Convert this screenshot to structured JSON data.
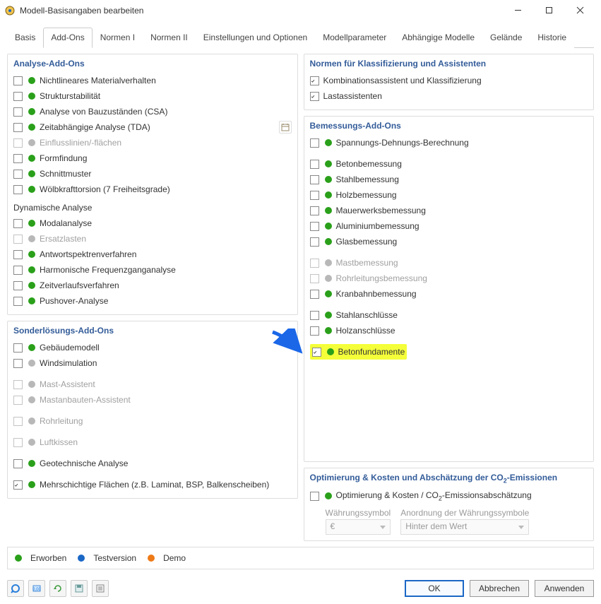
{
  "window": {
    "title": "Modell-Basisangaben bearbeiten"
  },
  "tabs": [
    "Basis",
    "Add-Ons",
    "Normen I",
    "Normen II",
    "Einstellungen und Optionen",
    "Modellparameter",
    "Abhängige Modelle",
    "Gelände",
    "Historie"
  ],
  "active_tab": 1,
  "panels": {
    "analysis": {
      "title": "Analyse-Add-Ons",
      "items": [
        {
          "label": "Nichtlineares Materialverhalten",
          "dot": "green",
          "checked": false,
          "disabled": false
        },
        {
          "label": "Strukturstabilität",
          "dot": "green",
          "checked": false,
          "disabled": false
        },
        {
          "label": "Analyse von Bauzuständen (CSA)",
          "dot": "green",
          "checked": false,
          "disabled": false
        },
        {
          "label": "Zeitabhängige Analyse (TDA)",
          "dot": "green",
          "checked": false,
          "disabled": false,
          "has_icon": true
        },
        {
          "label": "Einflusslinien/-flächen",
          "dot": "gray",
          "checked": false,
          "disabled": true
        },
        {
          "label": "Formfindung",
          "dot": "green",
          "checked": false,
          "disabled": false
        },
        {
          "label": "Schnittmuster",
          "dot": "green",
          "checked": false,
          "disabled": false
        },
        {
          "label": "Wölbkrafttorsion (7 Freiheitsgrade)",
          "dot": "green",
          "checked": false,
          "disabled": false
        }
      ],
      "dyn_header": "Dynamische Analyse",
      "dyn_items": [
        {
          "label": "Modalanalyse",
          "dot": "green",
          "checked": false,
          "disabled": false
        },
        {
          "label": "Ersatzlasten",
          "dot": "gray",
          "checked": false,
          "disabled": true
        },
        {
          "label": "Antwortspektrenverfahren",
          "dot": "green",
          "checked": false,
          "disabled": false
        },
        {
          "label": "Harmonische Frequenzganganalyse",
          "dot": "green",
          "checked": false,
          "disabled": false
        },
        {
          "label": "Zeitverlaufsverfahren",
          "dot": "green",
          "checked": false,
          "disabled": false
        },
        {
          "label": "Pushover-Analyse",
          "dot": "green",
          "checked": false,
          "disabled": false
        }
      ]
    },
    "special": {
      "title": "Sonderlösungs-Add-Ons",
      "items": [
        {
          "label": "Gebäudemodell",
          "dot": "green",
          "checked": false,
          "disabled": false
        },
        {
          "label": "Windsimulation",
          "dot": "gray",
          "checked": false,
          "disabled": false
        },
        {
          "label": "Mast-Assistent",
          "dot": "gray",
          "checked": false,
          "disabled": true
        },
        {
          "label": "Mastanbauten-Assistent",
          "dot": "gray",
          "checked": false,
          "disabled": true
        },
        {
          "label": "Rohrleitung",
          "dot": "gray",
          "checked": false,
          "disabled": true
        },
        {
          "label": "Luftkissen",
          "dot": "gray",
          "checked": false,
          "disabled": true
        },
        {
          "label": "Geotechnische Analyse",
          "dot": "green",
          "checked": false,
          "disabled": false
        },
        {
          "label": "Mehrschichtige Flächen (z.B. Laminat, BSP, Balkenscheiben)",
          "dot": "green",
          "checked": true,
          "disabled": false
        }
      ]
    },
    "norms": {
      "title": "Normen für Klassifizierung und Assistenten",
      "items": [
        {
          "label": "Kombinationsassistent und Klassifizierung",
          "checked": true
        },
        {
          "label": "Lastassistenten",
          "checked": true
        }
      ]
    },
    "design": {
      "title": "Bemessungs-Add-Ons",
      "items": [
        {
          "label": "Spannungs-Dehnungs-Berechnung",
          "dot": "green",
          "checked": false,
          "disabled": false,
          "gap_after": true
        },
        {
          "label": "Betonbemessung",
          "dot": "green",
          "checked": false,
          "disabled": false
        },
        {
          "label": "Stahlbemessung",
          "dot": "green",
          "checked": false,
          "disabled": false
        },
        {
          "label": "Holzbemessung",
          "dot": "green",
          "checked": false,
          "disabled": false
        },
        {
          "label": "Mauerwerksbemessung",
          "dot": "green",
          "checked": false,
          "disabled": false
        },
        {
          "label": "Aluminiumbemessung",
          "dot": "green",
          "checked": false,
          "disabled": false
        },
        {
          "label": "Glasbemessung",
          "dot": "green",
          "checked": false,
          "disabled": false,
          "gap_after": true
        },
        {
          "label": "Mastbemessung",
          "dot": "gray",
          "checked": false,
          "disabled": true
        },
        {
          "label": "Rohrleitungsbemessung",
          "dot": "gray",
          "checked": false,
          "disabled": true
        },
        {
          "label": "Kranbahnbemessung",
          "dot": "green",
          "checked": false,
          "disabled": false,
          "gap_after": true
        },
        {
          "label": "Stahlanschlüsse",
          "dot": "green",
          "checked": false,
          "disabled": false
        },
        {
          "label": "Holzanschlüsse",
          "dot": "green",
          "checked": false,
          "disabled": false,
          "gap_after": true
        },
        {
          "label": "Betonfundamente",
          "dot": "green",
          "checked": true,
          "disabled": false,
          "highlight": true
        }
      ]
    },
    "optimization": {
      "title": "Optimierung & Kosten und Abschätzung der CO2-Emissionen",
      "item": {
        "label": "Optimierung & Kosten / CO2-Emissionsabschätzung",
        "dot": "green",
        "checked": false
      },
      "currency_label": "Währungssymbol",
      "currency_value": "€",
      "arrangement_label": "Anordnung der Währungssymbole",
      "arrangement_value": "Hinter dem Wert"
    }
  },
  "legend": {
    "acquired": "Erworben",
    "test": "Testversion",
    "demo": "Demo"
  },
  "buttons": {
    "ok": "OK",
    "cancel": "Abbrechen",
    "apply": "Anwenden"
  },
  "co2_sub": "2"
}
